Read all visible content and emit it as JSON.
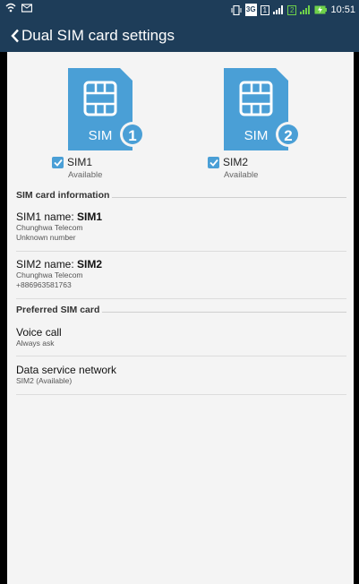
{
  "status_bar": {
    "time": "10:51",
    "signal_label_1": "1",
    "signal_label_2": "2",
    "network_badge": "3G"
  },
  "appbar": {
    "title": "Dual SIM card settings"
  },
  "sims": [
    {
      "number": "1",
      "chip_label": "SIM",
      "checkbox_label": "SIM1",
      "status": "Available",
      "checked": true
    },
    {
      "number": "2",
      "chip_label": "SIM",
      "checkbox_label": "SIM2",
      "status": "Available",
      "checked": true
    }
  ],
  "sim_info": {
    "header": "SIM card information",
    "sim1": {
      "name_prefix": "SIM1 name: ",
      "name_value": "SIM1",
      "carrier": "Chunghwa Telecom",
      "number": "Unknown number"
    },
    "sim2": {
      "name_prefix": "SIM2 name: ",
      "name_value": "SIM2",
      "carrier": "Chunghwa Telecom",
      "number": "+886963581763"
    }
  },
  "preferred": {
    "header": "Preferred SIM card",
    "voice": {
      "title": "Voice call",
      "value": "Always ask"
    },
    "data": {
      "title": "Data service network",
      "value": "SIM2 (Available)"
    }
  },
  "colors": {
    "bar": "#1e3d59",
    "accent": "#4a9fd6",
    "background": "#f4f4f4"
  }
}
